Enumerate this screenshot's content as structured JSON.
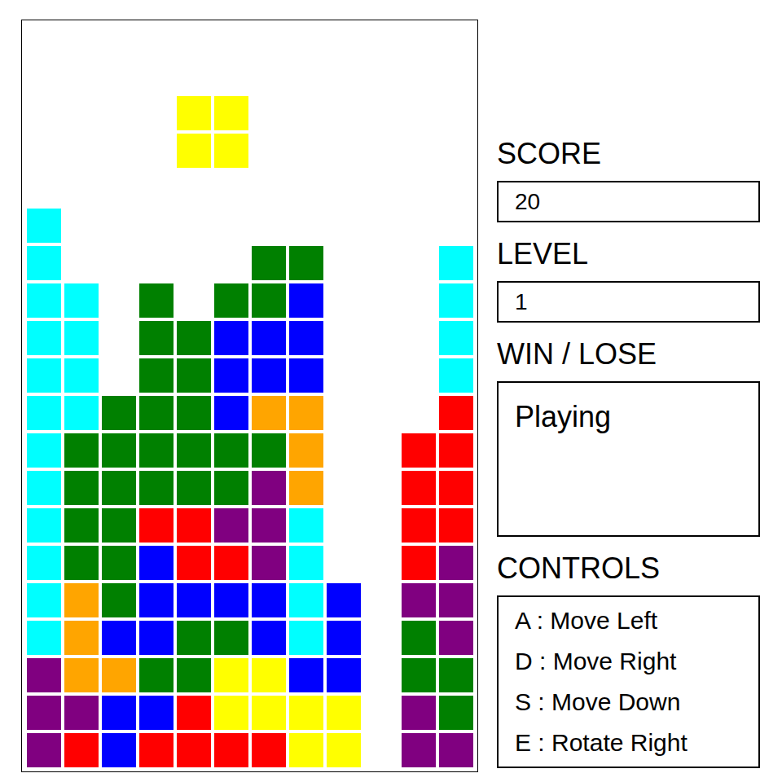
{
  "board": {
    "rows": [
      [
        null,
        null,
        null,
        null,
        null,
        null,
        null,
        null,
        null,
        null,
        null,
        null
      ],
      [
        null,
        null,
        null,
        null,
        null,
        null,
        null,
        null,
        null,
        null,
        null,
        null
      ],
      [
        null,
        null,
        null,
        null,
        "#ffff00",
        "#ffff00",
        null,
        null,
        null,
        null,
        null,
        null
      ],
      [
        null,
        null,
        null,
        null,
        "#ffff00",
        "#ffff00",
        null,
        null,
        null,
        null,
        null,
        null
      ],
      [
        null,
        null,
        null,
        null,
        null,
        null,
        null,
        null,
        null,
        null,
        null,
        null
      ],
      [
        "#00ffff",
        null,
        null,
        null,
        null,
        null,
        null,
        null,
        null,
        null,
        null,
        null
      ],
      [
        "#00ffff",
        null,
        null,
        null,
        null,
        null,
        "#008000",
        "#008000",
        null,
        null,
        null,
        "#00ffff"
      ],
      [
        "#00ffff",
        "#00ffff",
        null,
        "#008000",
        null,
        "#008000",
        "#008000",
        "#0000ff",
        null,
        null,
        null,
        "#00ffff"
      ],
      [
        "#00ffff",
        "#00ffff",
        null,
        "#008000",
        "#008000",
        "#0000ff",
        "#0000ff",
        "#0000ff",
        null,
        null,
        null,
        "#00ffff"
      ],
      [
        "#00ffff",
        "#00ffff",
        null,
        "#008000",
        "#008000",
        "#0000ff",
        "#0000ff",
        "#0000ff",
        null,
        null,
        null,
        "#00ffff"
      ],
      [
        "#00ffff",
        "#00ffff",
        "#008000",
        "#008000",
        "#008000",
        "#0000ff",
        "#ffa500",
        "#ffa500",
        null,
        null,
        null,
        "#ff0000"
      ],
      [
        "#00ffff",
        "#008000",
        "#008000",
        "#008000",
        "#008000",
        "#008000",
        "#008000",
        "#ffa500",
        null,
        null,
        "#ff0000",
        "#ff0000"
      ],
      [
        "#00ffff",
        "#008000",
        "#008000",
        "#008000",
        "#008000",
        "#008000",
        "#800080",
        "#ffa500",
        null,
        null,
        "#ff0000",
        "#ff0000"
      ],
      [
        "#00ffff",
        "#008000",
        "#008000",
        "#ff0000",
        "#ff0000",
        "#800080",
        "#800080",
        "#00ffff",
        null,
        null,
        "#ff0000",
        "#ff0000"
      ],
      [
        "#00ffff",
        "#008000",
        "#008000",
        "#0000ff",
        "#ff0000",
        "#ff0000",
        "#800080",
        "#00ffff",
        null,
        null,
        "#ff0000",
        "#800080"
      ],
      [
        "#00ffff",
        "#ffa500",
        "#008000",
        "#0000ff",
        "#0000ff",
        "#0000ff",
        "#0000ff",
        "#00ffff",
        "#0000ff",
        null,
        "#800080",
        "#800080"
      ],
      [
        "#00ffff",
        "#ffa500",
        "#0000ff",
        "#0000ff",
        "#008000",
        "#008000",
        "#0000ff",
        "#00ffff",
        "#0000ff",
        null,
        "#008000",
        "#800080"
      ],
      [
        "#800080",
        "#ffa500",
        "#ffa500",
        "#008000",
        "#008000",
        "#ffff00",
        "#ffff00",
        "#0000ff",
        "#0000ff",
        null,
        "#008000",
        "#008000"
      ],
      [
        "#800080",
        "#800080",
        "#0000ff",
        "#0000ff",
        "#ff0000",
        "#ffff00",
        "#ffff00",
        "#ffff00",
        "#ffff00",
        null,
        "#800080",
        "#008000"
      ],
      [
        "#800080",
        "#ff0000",
        "#0000ff",
        "#ff0000",
        "#ff0000",
        "#ff0000",
        "#ff0000",
        "#ffff00",
        "#ffff00",
        null,
        "#800080",
        "#800080"
      ]
    ]
  },
  "score": {
    "label": "SCORE",
    "value": "20"
  },
  "level": {
    "label": "LEVEL",
    "value": "1"
  },
  "status": {
    "label": "WIN / LOSE",
    "value": "Playing"
  },
  "controls": {
    "label": "CONTROLS",
    "items": [
      "A : Move Left",
      "D : Move Right",
      "S : Move Down",
      "E : Rotate Right"
    ]
  }
}
